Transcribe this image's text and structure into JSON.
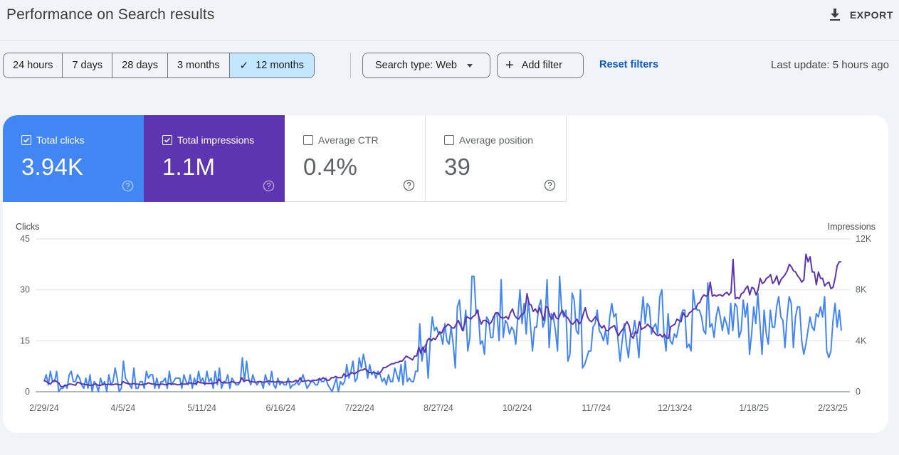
{
  "header": {
    "title": "Performance on Search results",
    "export_label": "EXPORT"
  },
  "filters": {
    "ranges": [
      {
        "label": "24 hours",
        "active": false
      },
      {
        "label": "7 days",
        "active": false
      },
      {
        "label": "28 days",
        "active": false
      },
      {
        "label": "3 months",
        "active": false
      },
      {
        "label": "12 months",
        "active": true
      }
    ],
    "search_type_label": "Search type: Web",
    "add_filter_label": "Add filter",
    "reset_filters_label": "Reset filters",
    "last_update": "Last update: 5 hours ago"
  },
  "metrics": [
    {
      "key": "clicks",
      "label": "Total clicks",
      "value": "3.94K",
      "checked": true,
      "color": "#4285f4"
    },
    {
      "key": "impr",
      "label": "Total impressions",
      "value": "1.1M",
      "checked": true,
      "color": "#5e35b1"
    },
    {
      "key": "ctr",
      "label": "Average CTR",
      "value": "0.4%",
      "checked": false
    },
    {
      "key": "pos",
      "label": "Average position",
      "value": "39",
      "checked": false
    }
  ],
  "chart_data": {
    "type": "line",
    "left_axis": {
      "title": "Clicks",
      "ticks": [
        "0",
        "15",
        "30",
        "45"
      ],
      "range": [
        0,
        45
      ]
    },
    "right_axis": {
      "title": "Impressions",
      "ticks": [
        "0",
        "4K",
        "8K",
        "12K"
      ],
      "range": [
        0,
        12000
      ]
    },
    "x_labels": [
      "2/29/24",
      "4/5/24",
      "5/11/24",
      "6/16/24",
      "7/22/24",
      "8/27/24",
      "10/2/24",
      "11/7/24",
      "12/13/24",
      "1/18/25",
      "2/23/25"
    ],
    "grid": true,
    "series": [
      {
        "name": "Clicks",
        "axis": "left",
        "color": "#4285f4",
        "values": [
          3,
          5,
          2,
          6,
          3,
          3,
          6,
          0,
          1,
          1,
          2,
          1,
          5,
          6,
          3,
          3,
          5,
          4,
          2,
          1,
          4,
          1,
          5,
          0,
          3,
          2,
          0,
          4,
          2,
          3,
          0,
          5,
          2,
          3,
          7,
          4,
          0,
          1,
          9,
          4,
          3,
          2,
          1,
          7,
          1,
          1,
          3,
          3,
          1,
          6,
          4,
          5,
          5,
          1,
          4,
          1,
          3,
          3,
          4,
          1,
          6,
          2,
          3,
          4,
          4,
          4,
          1,
          5,
          3,
          2,
          5,
          1,
          4,
          2,
          6,
          3,
          4,
          2,
          6,
          3,
          4,
          1,
          6,
          2,
          7,
          1,
          3,
          3,
          5,
          1,
          4,
          3,
          2,
          2,
          3,
          10,
          3,
          9,
          4,
          2,
          5,
          3,
          2,
          3,
          3,
          1,
          5,
          3,
          2,
          6,
          2,
          1,
          4,
          2,
          3,
          2,
          2,
          4,
          1,
          2,
          2,
          3,
          2,
          3,
          5,
          3,
          1,
          2,
          3,
          3,
          2,
          2,
          4,
          3,
          3,
          4,
          2,
          1,
          0,
          2,
          4,
          0,
          3,
          2,
          3,
          8,
          4,
          6,
          9,
          3,
          4,
          10,
          7,
          11,
          8,
          4,
          8,
          5,
          6,
          4,
          6,
          5,
          3,
          4,
          2,
          5,
          3,
          3,
          7,
          5,
          3,
          8,
          2,
          9,
          3,
          4,
          3,
          3,
          6,
          6,
          20,
          9,
          13,
          14,
          4,
          15,
          22,
          18,
          19,
          17,
          17,
          14,
          20,
          15,
          14,
          19,
          14,
          7,
          25,
          27,
          19,
          18,
          24,
          12,
          16,
          34,
          34,
          23,
          24,
          14,
          15,
          11,
          22,
          21,
          16,
          16,
          23,
          23,
          15,
          33,
          16,
          21,
          20,
          17,
          19,
          18,
          14,
          22,
          30,
          20,
          26,
          17,
          27,
          20,
          12,
          19,
          19,
          25,
          27,
          19,
          21,
          33,
          13,
          23,
          22,
          18,
          12,
          34,
          24,
          22,
          24,
          9,
          11,
          29,
          27,
          18,
          17,
          30,
          7,
          8,
          10,
          12,
          12,
          19,
          20,
          24,
          18,
          17,
          15,
          18,
          14,
          22,
          26,
          22,
          23,
          15,
          9,
          15,
          20,
          14,
          10,
          17,
          17,
          21,
          16,
          10,
          21,
          28,
          20,
          26,
          25,
          17,
          19,
          20,
          17,
          28,
          30,
          17,
          12,
          23,
          15,
          14,
          17,
          16,
          19,
          22,
          24,
          24,
          13,
          14,
          12,
          30,
          25,
          24,
          24,
          22,
          18,
          17,
          32,
          19,
          20,
          16,
          22,
          25,
          22,
          18,
          22,
          20,
          17,
          26,
          18,
          26,
          25,
          16,
          18,
          27,
          22,
          26,
          11,
          17,
          25,
          20,
          29,
          20,
          11,
          24,
          17,
          14,
          24,
          19,
          19,
          25,
          28,
          22,
          21,
          13,
          22,
          28,
          26,
          13,
          22,
          25,
          25,
          15,
          11,
          14,
          18,
          22,
          19,
          18,
          23,
          22,
          25,
          22,
          28,
          12,
          10,
          12,
          21,
          26,
          19,
          24,
          18
        ]
      },
      {
        "name": "Impressions",
        "axis": "right",
        "color": "#5e35b1",
        "values": [
          900,
          800,
          700,
          600,
          800,
          900,
          800,
          700,
          400,
          400,
          500,
          500,
          600,
          600,
          550,
          500,
          750,
          700,
          600,
          600,
          550,
          550,
          500,
          500,
          600,
          600,
          500,
          500,
          550,
          600,
          550,
          600,
          550,
          550,
          600,
          600,
          550,
          550,
          800,
          700,
          650,
          600,
          600,
          650,
          600,
          600,
          550,
          550,
          600,
          600,
          700,
          650,
          600,
          600,
          550,
          550,
          600,
          600,
          550,
          550,
          650,
          600,
          600,
          600,
          550,
          550,
          650,
          600,
          600,
          650,
          700,
          650,
          650,
          600,
          800,
          700,
          700,
          650,
          650,
          650,
          650,
          650,
          700,
          700,
          1000,
          750,
          700,
          700,
          700,
          700,
          800,
          750,
          700,
          700,
          750,
          1100,
          800,
          900,
          900,
          800,
          800,
          750,
          750,
          800,
          800,
          750,
          750,
          800,
          850,
          800,
          800,
          750,
          800,
          800,
          750,
          750,
          750,
          800,
          800,
          750,
          800,
          900,
          800,
          1100,
          800,
          850,
          850,
          900,
          800,
          900,
          900,
          900,
          1000,
          950,
          1100,
          1000,
          900,
          900,
          1100,
          1100,
          1200,
          1100,
          1100,
          1100,
          1400,
          1200,
          1300,
          1400,
          1500,
          1400,
          1500,
          1600,
          1700,
          1700,
          1800,
          1700,
          1500,
          1500,
          1500,
          1500,
          1400,
          1400,
          1600,
          1900,
          1900,
          2000,
          2100,
          2200,
          2200,
          2300,
          2300,
          2400,
          2400,
          2600,
          2800,
          2700,
          2600,
          2500,
          2800,
          2800,
          3500,
          3000,
          3500,
          3100,
          4000,
          4200,
          4000,
          4200,
          4100,
          4400,
          4700,
          4600,
          5000,
          5100,
          5300,
          5200,
          5000,
          5000,
          5300,
          5600,
          5200,
          4800,
          5300,
          5900,
          5800,
          5700,
          5900,
          6000,
          6400,
          5800,
          5300,
          5600,
          5600,
          5500,
          5300,
          5500,
          5900,
          6200,
          6200,
          5900,
          5800,
          5800,
          5900,
          5700,
          6200,
          6500,
          6000,
          5800,
          5700,
          6000,
          6100,
          6300,
          7700,
          6900,
          6800,
          6300,
          6500,
          6200,
          6600,
          6100,
          5600,
          6700,
          6600,
          5900,
          5700,
          6200,
          5800,
          5700,
          6100,
          6400,
          6000,
          5900,
          5700,
          5400,
          5300,
          5500,
          5700,
          5300,
          5500,
          6100,
          6600,
          5900,
          5600,
          5500,
          5700,
          5900,
          5600,
          5200,
          5000,
          5200,
          4800,
          4800,
          5000,
          5100,
          5200,
          4700,
          4400,
          4700,
          4900,
          5200,
          5500,
          5200,
          4400,
          4200,
          4700,
          4600,
          5500,
          4900,
          5000,
          5100,
          5300,
          5100,
          5000,
          4700,
          4500,
          4400,
          4500,
          4300,
          4500,
          4200,
          4200,
          5100,
          5200,
          5300,
          5700,
          5600,
          5500,
          6200,
          5900,
          5900,
          6200,
          6300,
          6500,
          6500,
          6900,
          7000,
          7400,
          7600,
          7500,
          7600,
          8600,
          7500,
          7600,
          7500,
          7600,
          7600,
          7500,
          7700,
          7800,
          7600,
          7800,
          10400,
          7300,
          7400,
          7300,
          7700,
          7800,
          8100,
          8300,
          7600,
          8200,
          8100,
          7600,
          8000,
          8900,
          8500,
          8600,
          8900,
          9000,
          9200,
          8500,
          8700,
          9100,
          8400,
          8800,
          9000,
          9200,
          9500,
          10000,
          9800,
          9500,
          9400,
          9100,
          8900,
          8600,
          8800,
          10800,
          10200,
          10600,
          9400,
          9400,
          8400,
          9400,
          8900,
          8900,
          8300,
          8500,
          8600,
          8100,
          8200,
          8900,
          9900,
          10200,
          10200
        ]
      }
    ]
  }
}
